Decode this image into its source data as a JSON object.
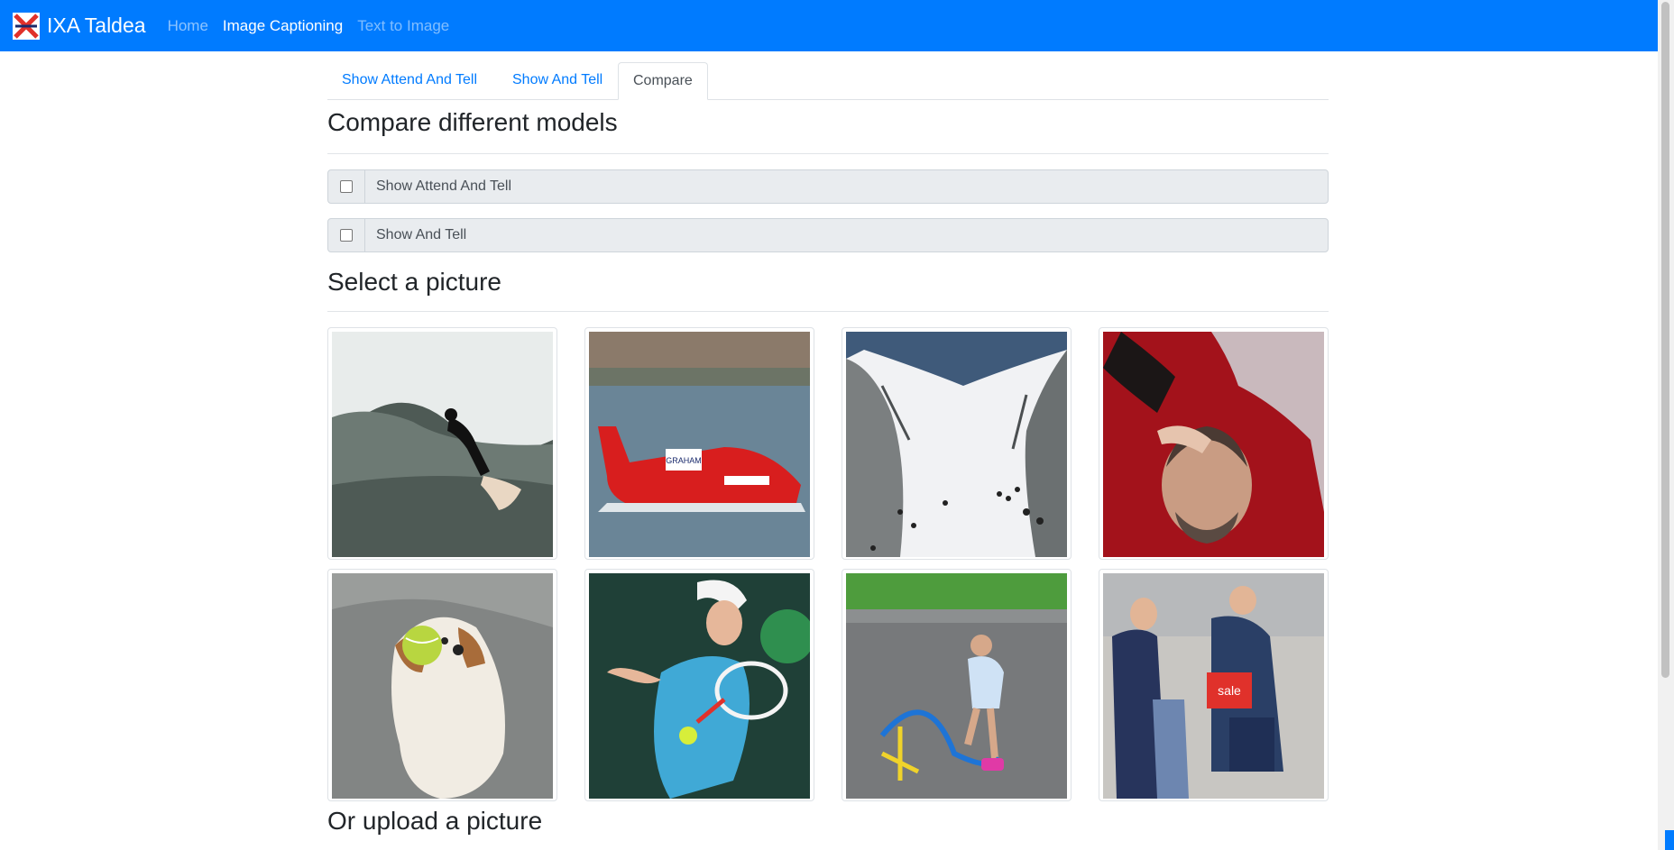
{
  "navbar": {
    "brand": "IXA Taldea",
    "links": [
      {
        "label": "Home"
      },
      {
        "label": "Image Captioning"
      },
      {
        "label": "Text to Image"
      }
    ]
  },
  "tabs": [
    {
      "label": "Show Attend And Tell"
    },
    {
      "label": "Show And Tell"
    },
    {
      "label": "Compare"
    }
  ],
  "compare": {
    "title": "Compare different models",
    "models": [
      {
        "label": "Show Attend And Tell",
        "checked": false
      },
      {
        "label": "Show And Tell",
        "checked": false
      }
    ]
  },
  "select": {
    "title": "Select a picture",
    "pictures": [
      {
        "subject": "surfer"
      },
      {
        "subject": "red powerboat",
        "text": "GRAHAM"
      },
      {
        "subject": "snowy ski slope"
      },
      {
        "subject": "child on man's shoulders"
      },
      {
        "subject": "dog catching tennis ball"
      },
      {
        "subject": "tennis player"
      },
      {
        "subject": "child with stomp rocket"
      },
      {
        "subject": "street crowd",
        "text": "sale"
      }
    ]
  },
  "upload": {
    "title": "Or upload a picture"
  },
  "colors": {
    "brand": "#007bff",
    "link": "#007bff"
  }
}
